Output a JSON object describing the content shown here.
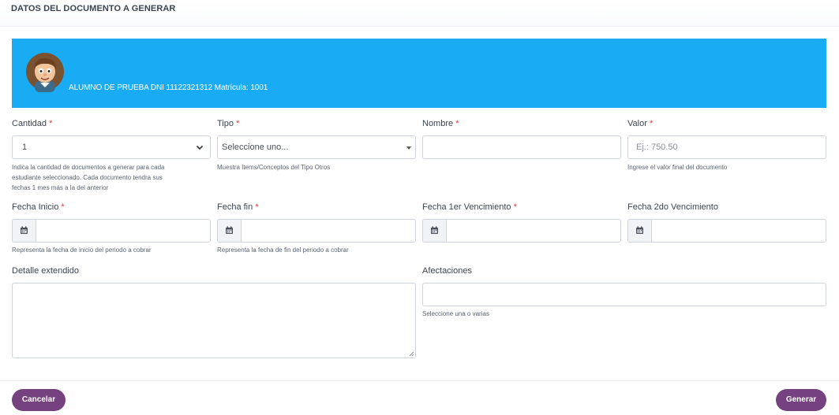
{
  "header": {
    "title": "DATOS DEL DOCUMENTO A GENERAR"
  },
  "banner": {
    "student": "ALUMNO DE PRUEBA DNI 11122321312 Matrícula: 1001",
    "color": "#1aabf5"
  },
  "fields": {
    "cantidad": {
      "label": "Cantidad",
      "required": "*",
      "value": "1",
      "help": [
        "Indica la cantidad de documentos a generar para cada",
        "estudiante seleccionado. Cada documento tendra sus",
        "fechas 1 mes más a la del anterior"
      ]
    },
    "tipo": {
      "label": "Tipo",
      "required": "*",
      "value": "Seleccione uno...",
      "help": "Muestra Items/Conceptos del Tipo Otros"
    },
    "nombre": {
      "label": "Nombre",
      "required": "*",
      "value": ""
    },
    "valor": {
      "label": "Valor",
      "required": "*",
      "placeholder": "Ej.: 750.50",
      "help": "Ingrese el valor final del documento"
    },
    "fecha_inicio": {
      "label": "Fecha Inicio",
      "required": "*",
      "help": "Representa la fecha de inicio del periodo a cobrar"
    },
    "fecha_fin": {
      "label": "Fecha fin",
      "required": "*",
      "help": "Representa la fecha de fin del periodo a cobrar"
    },
    "fecha_1er_venc": {
      "label": "Fecha 1er Vencimiento",
      "required": "*"
    },
    "fecha_2do_venc": {
      "label": "Fecha 2do Vencimiento"
    },
    "detalle": {
      "label": "Detalle extendido"
    },
    "afectaciones": {
      "label": "Afectaciones",
      "help": "Seleccione una o varias"
    }
  },
  "footer": {
    "cancel_label": "Cancelar",
    "generate_label": "Generar",
    "button_color": "#76417f"
  },
  "icons": {
    "avatar": "cartoon-student-avatar",
    "calendar": "calendar-icon",
    "chevron": "chevron-down-icon"
  }
}
